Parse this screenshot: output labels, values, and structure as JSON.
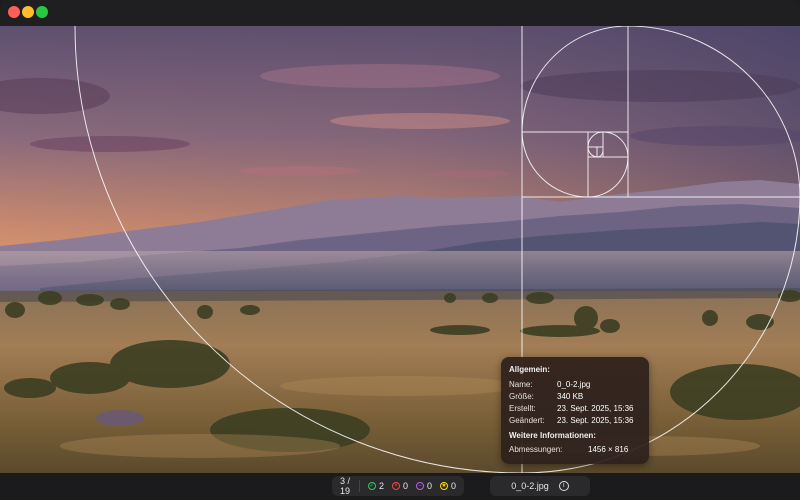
{
  "window": {
    "controls": [
      "close",
      "minimize",
      "maximize"
    ]
  },
  "bottom_bar": {
    "counter": "3 / 19",
    "badges": [
      {
        "icon": "check-circle-icon",
        "count": "2",
        "color": "#34c759"
      },
      {
        "icon": "x-circle-icon",
        "count": "0",
        "color": "#ff453a"
      },
      {
        "icon": "minus-circle-icon",
        "count": "0",
        "color": "#bf5af2"
      },
      {
        "icon": "star-circle-icon",
        "count": "0",
        "color": "#ffd60a"
      }
    ],
    "filename": "0_0-2.jpg",
    "info_icon": "info-icon"
  },
  "info_popover": {
    "general_heading": "Allgemein:",
    "name_label": "Name:",
    "name_value": "0_0-2.jpg",
    "size_label": "Größe:",
    "size_value": "340 KB",
    "created_label": "Erstellt:",
    "created_value": "23. Sept. 2025, 15:36",
    "modified_label": "Geändert:",
    "modified_value": "23. Sept. 2025, 15:36",
    "more_heading": "Weitere Informationen:",
    "dimensions_label": "Abmessungen:",
    "dimensions_value": "1456 × 816"
  },
  "overlay": {
    "type": "golden-spiral",
    "stroke_color": "#ffffff"
  }
}
